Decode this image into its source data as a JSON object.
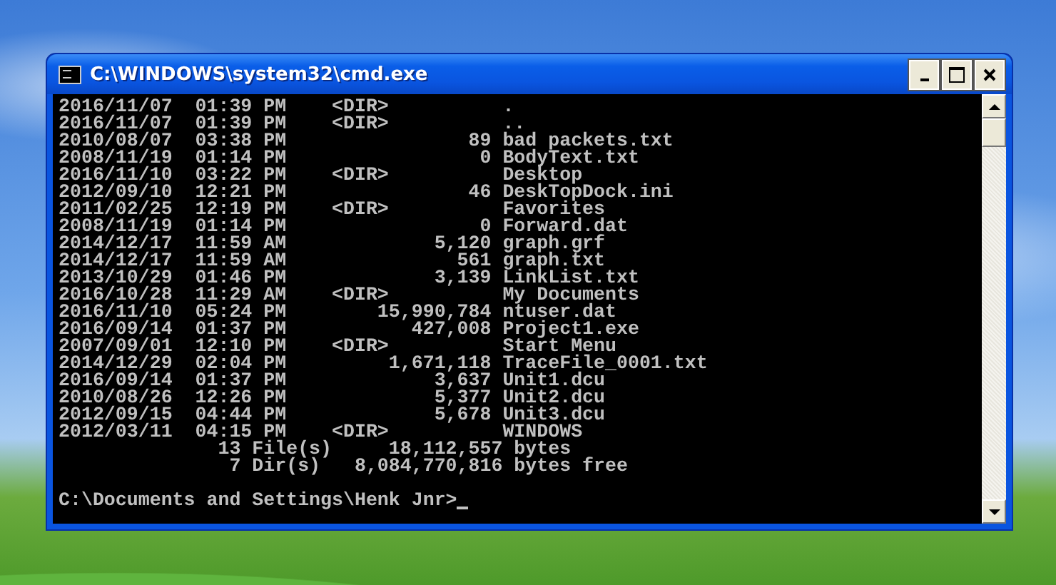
{
  "window": {
    "title": "C:\\WINDOWS\\system32\\cmd.exe"
  },
  "console": {
    "lines": [
      {
        "kind": "listing",
        "text": "2016/11/07  01:39 PM    <DIR>          ."
      },
      {
        "kind": "listing",
        "text": "2016/11/07  01:39 PM    <DIR>          .."
      },
      {
        "kind": "listing",
        "text": "2010/08/07  03:38 PM                89 bad packets.txt"
      },
      {
        "kind": "listing",
        "text": "2008/11/19  01:14 PM                 0 BodyText.txt"
      },
      {
        "kind": "listing",
        "text": "2016/11/10  03:22 PM    <DIR>          Desktop"
      },
      {
        "kind": "listing",
        "text": "2012/09/10  12:21 PM                46 DeskTopDock.ini"
      },
      {
        "kind": "listing",
        "text": "2011/02/25  12:19 PM    <DIR>          Favorites"
      },
      {
        "kind": "listing",
        "text": "2008/11/19  01:14 PM                 0 Forward.dat"
      },
      {
        "kind": "listing",
        "text": "2014/12/17  11:59 AM             5,120 graph.grf"
      },
      {
        "kind": "listing",
        "text": "2014/12/17  11:59 AM               561 graph.txt"
      },
      {
        "kind": "listing",
        "text": "2013/10/29  01:46 PM             3,139 LinkList.txt"
      },
      {
        "kind": "listing",
        "text": "2016/10/28  11:29 AM    <DIR>          My Documents"
      },
      {
        "kind": "listing",
        "text": "2016/11/10  05:24 PM        15,990,784 ntuser.dat"
      },
      {
        "kind": "listing",
        "text": "2016/09/14  01:37 PM           427,008 Project1.exe"
      },
      {
        "kind": "listing",
        "text": "2007/09/01  12:10 PM    <DIR>          Start Menu"
      },
      {
        "kind": "listing",
        "text": "2014/12/29  02:04 PM         1,671,118 TraceFile_0001.txt"
      },
      {
        "kind": "listing",
        "text": "2016/09/14  01:37 PM             3,637 Unit1.dcu"
      },
      {
        "kind": "listing",
        "text": "2010/08/26  12:26 PM             5,377 Unit2.dcu"
      },
      {
        "kind": "listing",
        "text": "2012/09/15  04:44 PM             5,678 Unit3.dcu"
      },
      {
        "kind": "listing",
        "text": "2012/03/11  04:15 PM    <DIR>          WINDOWS"
      },
      {
        "kind": "summary",
        "text": "              13 File(s)     18,112,557 bytes"
      },
      {
        "kind": "summary",
        "text": "               7 Dir(s)   8,084,770,816 bytes free"
      },
      {
        "kind": "prompt",
        "text": "C:\\Documents and Settings\\Henk Jnr>"
      }
    ]
  }
}
